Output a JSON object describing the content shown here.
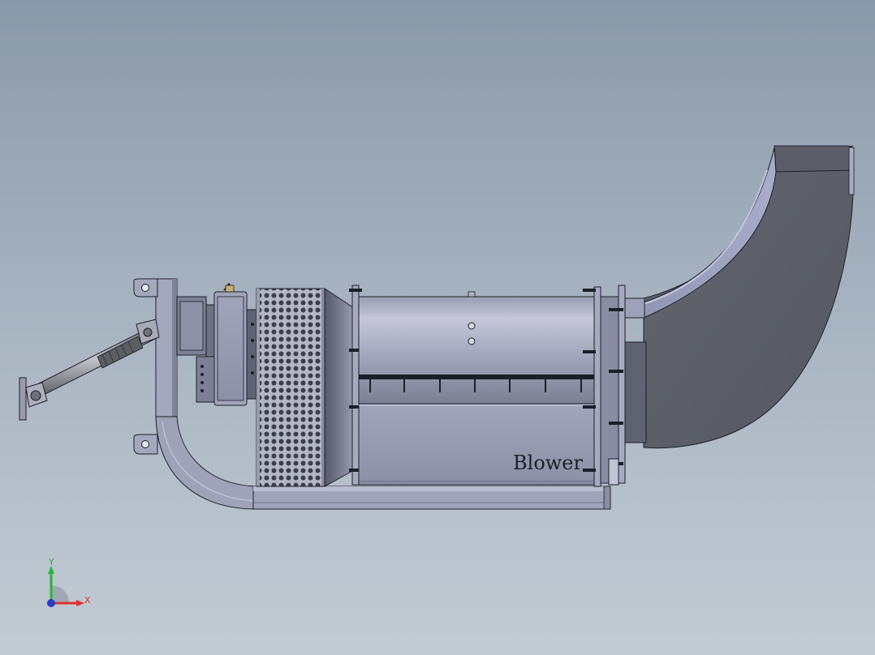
{
  "model": {
    "label": "Blower"
  },
  "triad": {
    "x_label": "X",
    "y_label": "Y",
    "x_color": "#e03030",
    "y_color": "#27b43a",
    "z_color": "#2a3cc8"
  },
  "colors": {
    "background_top": "#8a99a9",
    "background_bottom": "#c3cbd4",
    "body_light": "#a8acc2",
    "body_dark": "#5e6170",
    "outline": "#1c1f27"
  }
}
